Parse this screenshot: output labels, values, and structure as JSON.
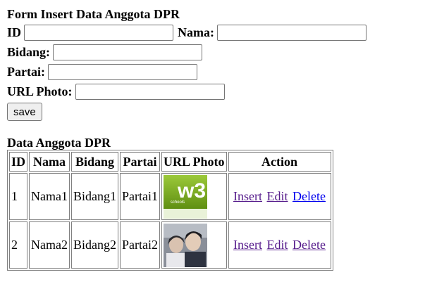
{
  "form": {
    "title": "Form Insert Data Anggota DPR",
    "id_label": "ID",
    "nama_label": "Nama:",
    "bidang_label": "Bidang:",
    "partai_label": "Partai:",
    "url_label": "URL Photo:",
    "id_value": "",
    "nama_value": "",
    "bidang_value": "",
    "partai_value": "",
    "url_value": "",
    "save_label": "save"
  },
  "table": {
    "title": "Data Anggota DPR",
    "headers": [
      "ID",
      "Nama",
      "Bidang",
      "Partai",
      "URL Photo",
      "Action"
    ],
    "rows": [
      {
        "id": "1",
        "nama": "Nama1",
        "bidang": "Bidang1",
        "partai": "Partai1",
        "photo_logo_text": "w3",
        "photo_logo_sub": "schools"
      },
      {
        "id": "2",
        "nama": "Nama2",
        "bidang": "Bidang2",
        "partai": "Partai2"
      }
    ],
    "actions": {
      "insert": "Insert",
      "edit": "Edit",
      "delete": "Delete"
    }
  },
  "colors": {
    "link_visited": "#551a8b",
    "link_unvisited": "#0000ee",
    "w3_green": "#7cae1c"
  }
}
